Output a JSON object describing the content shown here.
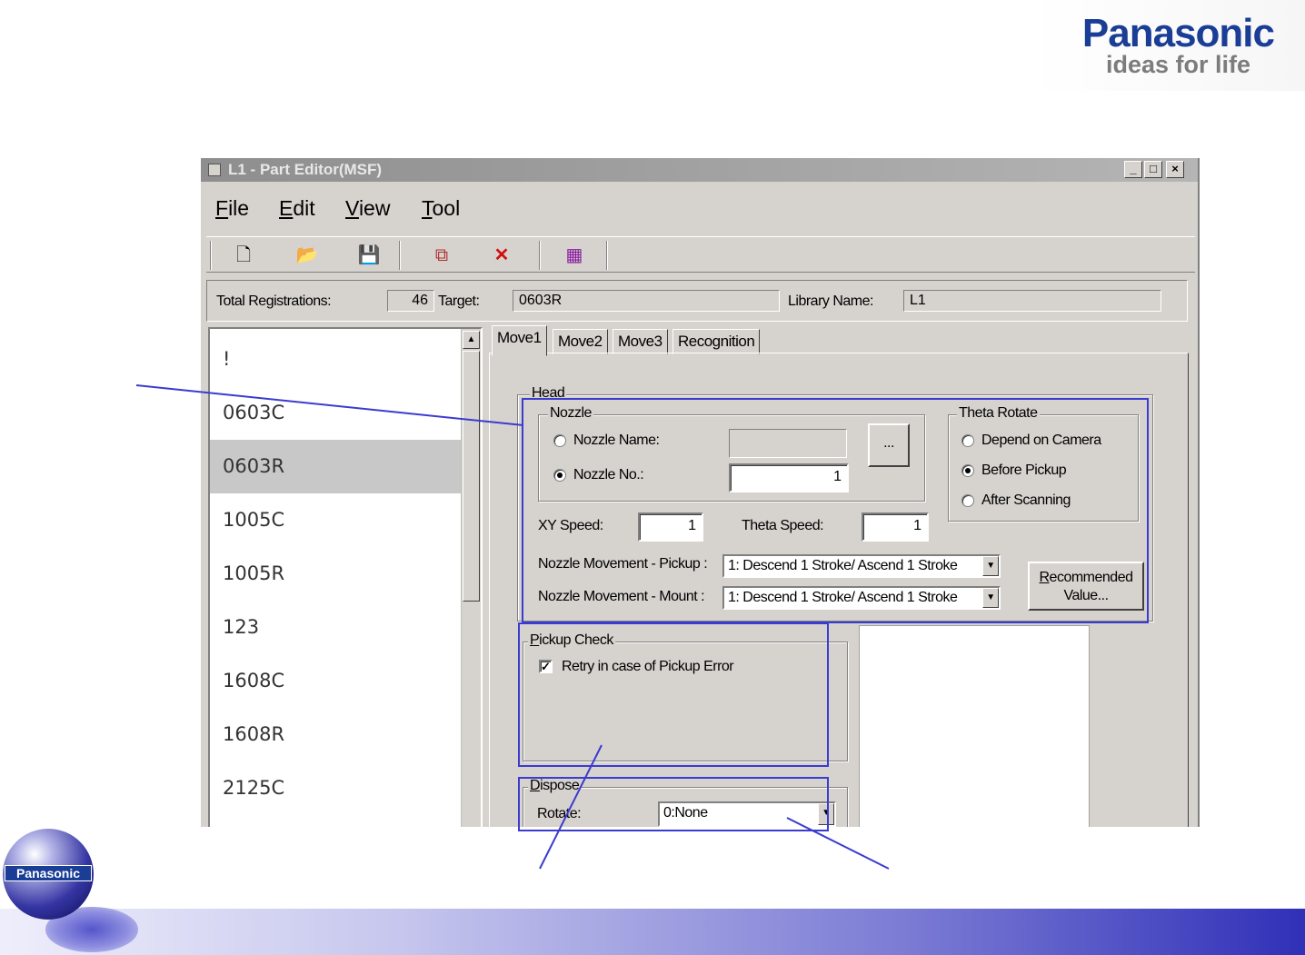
{
  "brand": {
    "name": "Panasonic",
    "tagline": "ideas for life",
    "badge": "Panasonic"
  },
  "window": {
    "title": "L1 - Part Editor(MSF)",
    "controls": {
      "minimize": "_",
      "maximize": "□",
      "close": "×"
    }
  },
  "menu": {
    "file": {
      "key": "F",
      "rest": "ile"
    },
    "edit": {
      "key": "E",
      "rest": "dit"
    },
    "view": {
      "key": "V",
      "rest": "iew"
    },
    "tool": {
      "key": "T",
      "rest": "ool"
    }
  },
  "toolbar": {
    "new_glyph": "🗋",
    "open_glyph": "📂",
    "save_glyph": "💾",
    "copy_glyph": "⧉",
    "delete_glyph": "✕",
    "tool_glyph": "▦"
  },
  "info": {
    "total_label": "Total Registrations:",
    "total_value": "46",
    "target_label": "Target:",
    "target_value": "0603R",
    "library_label": "Library Name:",
    "library_value": "L1"
  },
  "parts_list": {
    "items": [
      "!",
      "0603C",
      "0603R",
      "1005C",
      "1005R",
      "123",
      "1608C",
      "1608R",
      "2125C"
    ],
    "selected_index": 2,
    "scroll_up": "▲"
  },
  "tabs": [
    "Move1",
    "Move2",
    "Move3",
    "Recognition"
  ],
  "head": {
    "title": "Head",
    "nozzle": {
      "title": "Nozzle",
      "name_label": "Nozzle Name:",
      "name_value": "",
      "no_label": "Nozzle No.:",
      "no_value": "1",
      "selected": "no",
      "browse_label": "..."
    },
    "theta_rotate": {
      "title": "Theta Rotate",
      "options": [
        "Depend on Camera",
        "Before Pickup",
        "After Scanning"
      ],
      "selected_index": 1
    },
    "xy_speed_label": "XY Speed:",
    "xy_speed_value": "1",
    "theta_speed_label": "Theta Speed:",
    "theta_speed_value": "1",
    "pickup_movement_label": "Nozzle Movement - Pickup :",
    "pickup_movement_value": "1: Descend 1 Stroke/ Ascend 1 Stroke",
    "mount_movement_label": "Nozzle Movement - Mount :",
    "mount_movement_value": "1: Descend 1 Stroke/ Ascend 1 Stroke",
    "recommended_key": "R",
    "recommended_rest": "ecommended",
    "recommended_line2": "Value..."
  },
  "pickup_check": {
    "title_key": "P",
    "title_rest": "ickup Check",
    "retry_label": "Retry in case of Pickup Error",
    "retry_checked": true,
    "check_glyph": "✓"
  },
  "dispose": {
    "title_key": "D",
    "title_rest": "ispose",
    "rotate_label": "Rotate:",
    "rotate_value": "0:None"
  },
  "dropdown_glyph": "▼",
  "colors": {
    "annotation": "#3b3bd0",
    "brand": "#1a3d96",
    "window_bg": "#d6d3ce"
  }
}
